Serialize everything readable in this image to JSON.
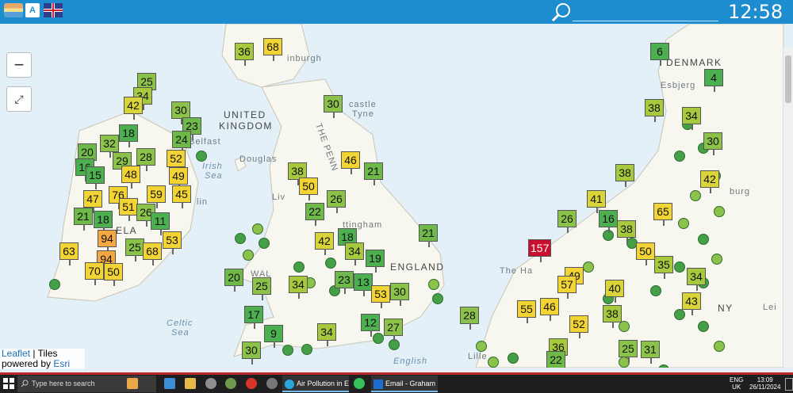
{
  "topbar": {
    "translate_icon_text": "A",
    "search_placeholder": "",
    "clock": "12:58"
  },
  "map": {
    "zoom_out": "−",
    "fullscreen": "⤢",
    "labels": {
      "denmark": "DENMARK",
      "esbjerg": "Esbjerg",
      "edinburgh": "inburgh",
      "uk1": "UNITED",
      "uk2": "KINGDOM",
      "belfast": "Belfast",
      "newcastle1": "castle",
      "newcastle2": "Tyne",
      "douglas": "Douglas",
      "irish_sea1": "Irish",
      "irish_sea2": "Sea",
      "penn": "THE PENN",
      "nottingham": "ttingham",
      "england": "ENGLAND",
      "wales": "WAL",
      "celtic1": "Celtic",
      "celtic2": "Sea",
      "english": "English",
      "ela": "ELA",
      "liv": "Liv",
      "lin": "lin",
      "the_ha": "The Ha",
      "burg": "burg",
      "ny": "NY",
      "lei": "Lei",
      "lille": "Lille"
    },
    "markers": [
      {
        "v": "25",
        "c": "#8bc34a"
      },
      {
        "v": "34",
        "c": "#a6c93e"
      },
      {
        "v": "42",
        "c": "#d8d43a"
      },
      {
        "v": "30",
        "c": "#8bc34a"
      },
      {
        "v": "23",
        "c": "#6fb84a"
      },
      {
        "v": "18",
        "c": "#4caf50"
      },
      {
        "v": "32",
        "c": "#8bc34a"
      },
      {
        "v": "24",
        "c": "#6fb84a"
      },
      {
        "v": "20",
        "c": "#6fb84a"
      },
      {
        "v": "29",
        "c": "#8bc34a"
      },
      {
        "v": "28",
        "c": "#8bc34a"
      },
      {
        "v": "16",
        "c": "#4caf50"
      },
      {
        "v": "15",
        "c": "#4caf50"
      },
      {
        "v": "48",
        "c": "#f2d535"
      },
      {
        "v": "52",
        "c": "#f2d535"
      },
      {
        "v": "49",
        "c": "#f2d535"
      },
      {
        "v": "47",
        "c": "#f2d535"
      },
      {
        "v": "76",
        "c": "#f2d535"
      },
      {
        "v": "59",
        "c": "#f2d535"
      },
      {
        "v": "45",
        "c": "#f2d535"
      },
      {
        "v": "51",
        "c": "#f2d535"
      },
      {
        "v": "26",
        "c": "#8bc34a"
      },
      {
        "v": "21",
        "c": "#6fb84a"
      },
      {
        "v": "18",
        "c": "#4caf50"
      },
      {
        "v": "11",
        "c": "#4caf50"
      },
      {
        "v": "94",
        "c": "#f5a742"
      },
      {
        "v": "25",
        "c": "#8bc34a"
      },
      {
        "v": "53",
        "c": "#f2d535"
      },
      {
        "v": "63",
        "c": "#f2d535"
      },
      {
        "v": "94",
        "c": "#f5a742"
      },
      {
        "v": "68",
        "c": "#f2d535"
      },
      {
        "v": "70",
        "c": "#f2d535"
      },
      {
        "v": "50",
        "c": "#f2d535"
      },
      {
        "v": "36",
        "c": "#a6c93e"
      },
      {
        "v": "68",
        "c": "#f2d535"
      },
      {
        "v": "30",
        "c": "#8bc34a"
      },
      {
        "v": "38",
        "c": "#a6c93e"
      },
      {
        "v": "46",
        "c": "#f2d535"
      },
      {
        "v": "21",
        "c": "#6fb84a"
      },
      {
        "v": "50",
        "c": "#f2d535"
      },
      {
        "v": "26",
        "c": "#8bc34a"
      },
      {
        "v": "22",
        "c": "#6fb84a"
      },
      {
        "v": "18",
        "c": "#4caf50"
      },
      {
        "v": "42",
        "c": "#d8d43a"
      },
      {
        "v": "34",
        "c": "#a6c93e"
      },
      {
        "v": "19",
        "c": "#4caf50"
      },
      {
        "v": "21",
        "c": "#6fb84a"
      },
      {
        "v": "20",
        "c": "#6fb84a"
      },
      {
        "v": "25",
        "c": "#8bc34a"
      },
      {
        "v": "34",
        "c": "#a6c93e"
      },
      {
        "v": "23",
        "c": "#6fb84a"
      },
      {
        "v": "13",
        "c": "#4caf50"
      },
      {
        "v": "53",
        "c": "#f2d535"
      },
      {
        "v": "30",
        "c": "#8bc34a"
      },
      {
        "v": "17",
        "c": "#4caf50"
      },
      {
        "v": "12",
        "c": "#4caf50"
      },
      {
        "v": "27",
        "c": "#8bc34a"
      },
      {
        "v": "9",
        "c": "#4caf50"
      },
      {
        "v": "34",
        "c": "#a6c93e"
      },
      {
        "v": "30",
        "c": "#8bc34a"
      },
      {
        "v": "6",
        "c": "#4caf50"
      },
      {
        "v": "4",
        "c": "#4caf50"
      },
      {
        "v": "38",
        "c": "#a6c93e"
      },
      {
        "v": "34",
        "c": "#a6c93e"
      },
      {
        "v": "30",
        "c": "#8bc34a"
      },
      {
        "v": "42",
        "c": "#d8d43a"
      },
      {
        "v": "38",
        "c": "#a6c93e"
      },
      {
        "v": "41",
        "c": "#d8d43a"
      },
      {
        "v": "65",
        "c": "#f2d535"
      },
      {
        "v": "26",
        "c": "#8bc34a"
      },
      {
        "v": "16",
        "c": "#4caf50"
      },
      {
        "v": "38",
        "c": "#a6c93e"
      },
      {
        "v": "157",
        "c": "#c8102e"
      },
      {
        "v": "50",
        "c": "#f2d535"
      },
      {
        "v": "35",
        "c": "#a6c93e"
      },
      {
        "v": "34",
        "c": "#a6c93e"
      },
      {
        "v": "49",
        "c": "#f2d535"
      },
      {
        "v": "57",
        "c": "#f2d535"
      },
      {
        "v": "40",
        "c": "#d8d43a"
      },
      {
        "v": "43",
        "c": "#d8d43a"
      },
      {
        "v": "55",
        "c": "#f2d535"
      },
      {
        "v": "46",
        "c": "#f2d535"
      },
      {
        "v": "52",
        "c": "#f2d535"
      },
      {
        "v": "38",
        "c": "#a6c93e"
      },
      {
        "v": "36",
        "c": "#a6c93e"
      },
      {
        "v": "22",
        "c": "#6fb84a"
      },
      {
        "v": "31",
        "c": "#8bc34a"
      },
      {
        "v": "25",
        "c": "#8bc34a"
      },
      {
        "v": "28",
        "c": "#8bc34a"
      }
    ]
  },
  "attribution": {
    "leaflet": "Leaflet",
    "sep": " | ",
    "tiles": "Tiles",
    "powered": "powered by",
    "esri": "Esri"
  },
  "taskbar": {
    "search_placeholder": "Type here to search",
    "app1": "Air Pollution in Eur...",
    "app2": "Email - Graham But...",
    "lang1": "ENG",
    "lang2": "UK",
    "time": "13:09",
    "date": "26/11/2024"
  }
}
